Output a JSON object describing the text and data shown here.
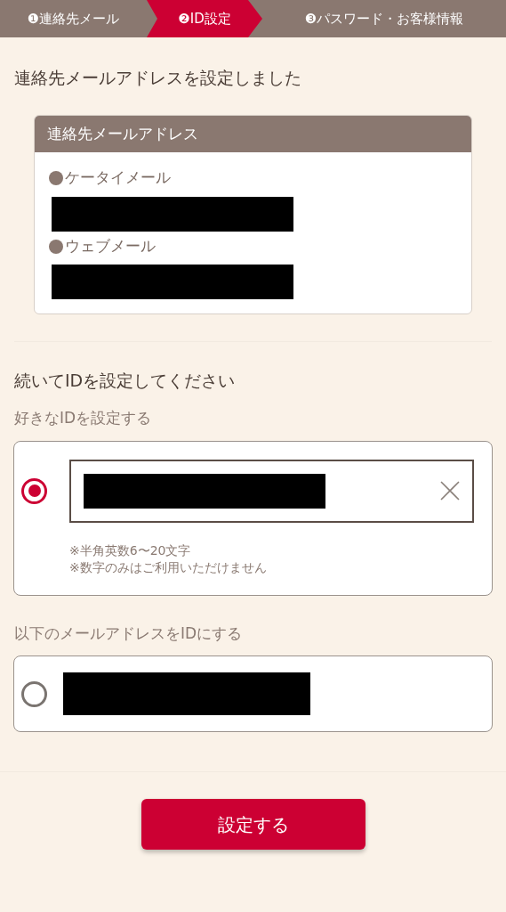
{
  "steps": [
    {
      "label": "❶連絡先メール",
      "selected": false
    },
    {
      "label": "❷ID設定",
      "selected": true
    },
    {
      "label": "❸パスワード・お客様情報",
      "selected": false
    }
  ],
  "heading": "連絡先メールアドレスを設定しました",
  "contact_card": {
    "title": "連絡先メールアドレス",
    "entries": [
      {
        "label": "ケータイメール"
      },
      {
        "label": "ウェブメール"
      }
    ]
  },
  "id_heading": "続いてIDを設定してください",
  "options": [
    {
      "kind": "input",
      "label": "好きなIDを設定する",
      "selected": true,
      "notes": [
        "※半角英数6〜20文字",
        "※数字のみはご利用いただけません"
      ]
    },
    {
      "kind": "email",
      "label": "以下のメールアドレスをIDにする",
      "selected": false
    }
  ],
  "submit": "設定する"
}
